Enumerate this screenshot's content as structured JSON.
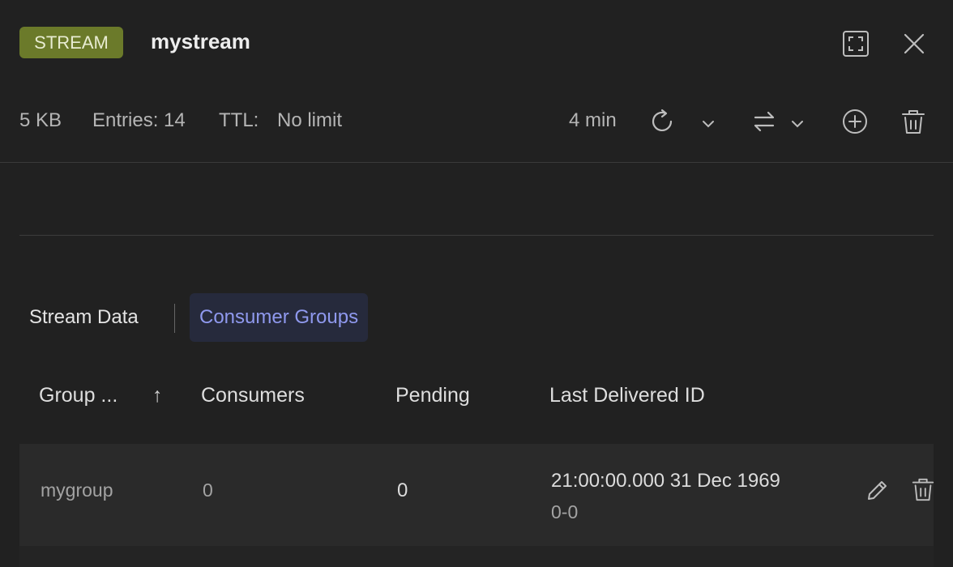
{
  "header": {
    "type_badge": "STREAM",
    "key_name": "mystream"
  },
  "meta": {
    "size": "5 KB",
    "entries": "Entries: 14",
    "ttl_label": "TTL:",
    "ttl_value": "No limit",
    "refresh_age": "4 min"
  },
  "tabs": [
    {
      "label": "Stream Data",
      "active": false
    },
    {
      "label": "Consumer Groups",
      "active": true
    }
  ],
  "table": {
    "columns": [
      "Group ...",
      "Consumers",
      "Pending",
      "Last Delivered ID"
    ],
    "sort_indicator": "↑",
    "rows": [
      {
        "group": "mygroup",
        "consumers": "0",
        "pending": "0",
        "last_delivered_time": "21:00:00.000 31 Dec 1969",
        "last_delivered_id": "0-0"
      }
    ]
  },
  "colors": {
    "badge": "#6b7a2a",
    "active_tab_bg": "#262a3c",
    "active_tab_text": "#8f99ee"
  }
}
